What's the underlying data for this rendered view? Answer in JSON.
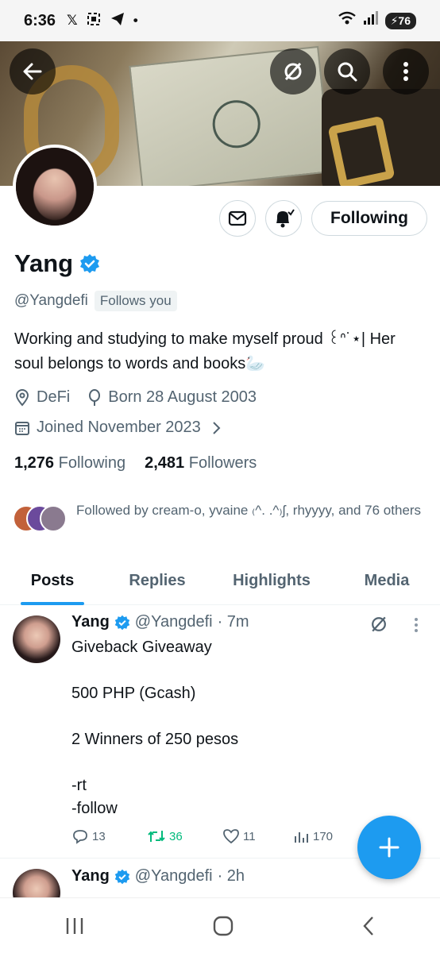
{
  "status_bar": {
    "time": "6:36",
    "notif_icons": [
      "x-logo-icon",
      "screenshot-icon",
      "telegram-icon",
      "dot-icon"
    ],
    "battery": "76"
  },
  "profile": {
    "name": "Yang",
    "handle": "@Yangdefi",
    "follows_you": "Follows you",
    "bio": "Working and studying to make myself proud ꒰ᐢ˙⋆| Her soul belongs to words and books🦢",
    "category": "DeFi",
    "born": "Born 28 August 2003",
    "joined": "Joined November 2023",
    "following_count": "1,276",
    "following_label": "Following",
    "followers_count": "2,481",
    "followers_label": "Followers",
    "followed_by": "Followed by cream-o, yvaine ₍^. .^₎ʃ, rhyyyy, and 76 others",
    "follow_button": "Following"
  },
  "tabs": [
    {
      "label": "Posts"
    },
    {
      "label": "Replies"
    },
    {
      "label": "Highlights"
    },
    {
      "label": "Media"
    }
  ],
  "tweets": [
    {
      "name": "Yang",
      "handle": "@Yangdefi",
      "time": "· 7m",
      "body": "Giveback Giveaway\n\n500 PHP (Gcash)\n\n2 Winners of 250 pesos\n\n-rt\n-follow",
      "replies": "13",
      "retweets": "36",
      "likes": "11",
      "views": "170"
    },
    {
      "name": "Yang",
      "handle": "@Yangdefi",
      "time": "· 2h"
    }
  ],
  "colors": {
    "accent": "#1d9bf0",
    "retweet": "#00ba7c",
    "secondary_text": "#536471"
  }
}
